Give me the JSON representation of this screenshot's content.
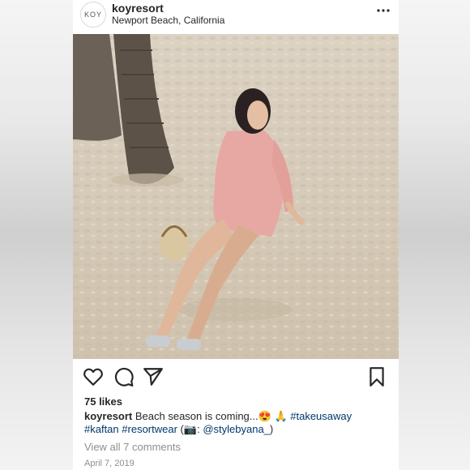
{
  "post": {
    "avatar_text": "KOY",
    "username": "koyresort",
    "location": "Newport Beach, California",
    "more_icon": "more-horizontal-icon",
    "likes": "75 likes",
    "caption": {
      "username": "koyresort",
      "text_1": "Beach season is coming...",
      "emoji_1": "😍",
      "emoji_2": "🙏",
      "hashtag_1": "#takeusaway",
      "hashtag_2": "#kaftan",
      "hashtag_3": "#resortwear",
      "paren_open": "(",
      "camera_emoji": "📷",
      "colon": ":",
      "mention": "@stylebyana_",
      "paren_close": ")"
    },
    "view_comments": "View all 7 comments",
    "date": "April 7, 2019"
  },
  "photo_description_icon": "beach-photo",
  "colors": {
    "text": "#262626",
    "muted": "#8e8e8e",
    "link": "#00376b",
    "sand": "#d8cdbc"
  }
}
